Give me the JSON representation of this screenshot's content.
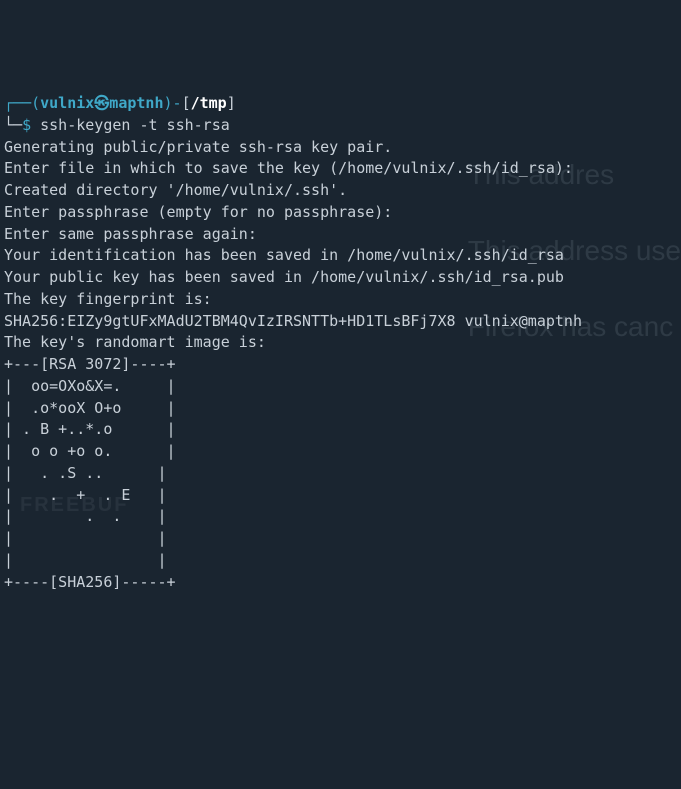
{
  "prompt": {
    "dash_open": "┌──(",
    "user_host": "vulnix㉿maptnh",
    "dash_mid": ")-",
    "path_open": "[",
    "path": "/tmp",
    "path_close": "]",
    "line2_prefix": "└─",
    "dollar": "$",
    "command": " ssh-keygen -t ssh-rsa"
  },
  "output": [
    "Generating public/private ssh-rsa key pair.",
    "Enter file in which to save the key (/home/vulnix/.ssh/id_rsa):",
    "Created directory '/home/vulnix/.ssh'.",
    "Enter passphrase (empty for no passphrase):",
    "Enter same passphrase again:",
    "Your identification has been saved in /home/vulnix/.ssh/id_rsa",
    "Your public key has been saved in /home/vulnix/.ssh/id_rsa.pub",
    "The key fingerprint is:",
    "SHA256:EIZy9gtUFxMAdU2TBM4QvIzIRSNTTb+HD1TLsBFj7X8 vulnix@maptnh",
    "The key's randomart image is:",
    "+---[RSA 3072]----+",
    "|  oo=OXo&X=.     |",
    "|  .o*ooX O+o     |",
    "| . B +..*.o      |",
    "|  o o +o o.      |",
    "|   . .S ..      |",
    "|    .  +  . E   |",
    "|        .  .    |",
    "|                |",
    "|                |",
    "+----[SHA256]-----+"
  ],
  "watermark": {
    "line1": "This addres",
    "line2": "This address use",
    "line3": "Firefox has canc"
  },
  "brand": "FREEBUF"
}
